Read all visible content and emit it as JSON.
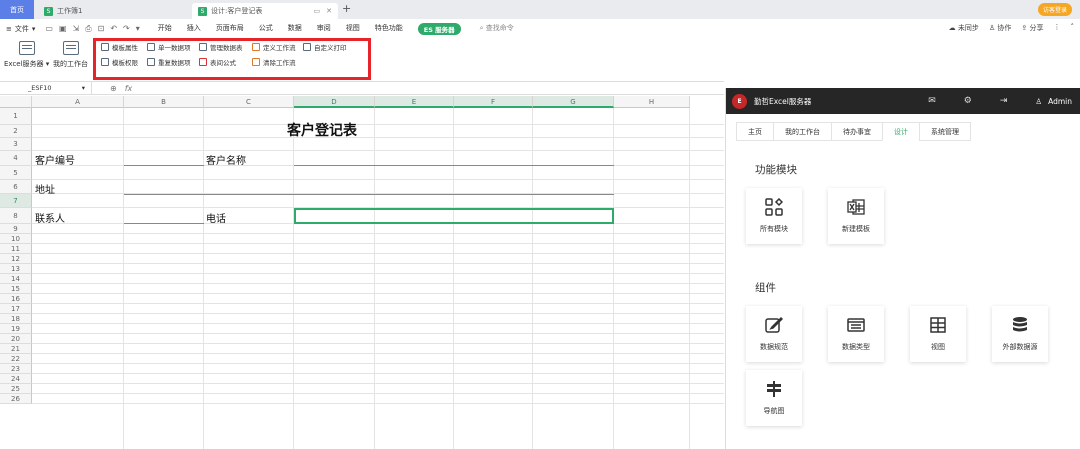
{
  "tabbar": {
    "home": "首页",
    "workbook": "工作簿1",
    "design_tab": "设计:客户登记表",
    "add": "+",
    "visitor_login": "访客登录"
  },
  "menubar": {
    "file": "文件",
    "items": [
      "开始",
      "插入",
      "页面布局",
      "公式",
      "数据",
      "审阅",
      "视图",
      "特色功能"
    ],
    "es_button": "ES 服务器",
    "search": "查找命令",
    "right_items": [
      "未同步",
      "协作",
      "分享"
    ]
  },
  "ribbon": {
    "excel_server": "Excel服务器",
    "my_workbench": "我的工作台",
    "row1": [
      "模板属性",
      "单一数据项",
      "管理数据表",
      "定义工作流",
      "自定义打印"
    ],
    "row2": [
      "模板权限",
      "重复数据项",
      "表间公式",
      "清除工作流"
    ]
  },
  "formula_bar": {
    "name_box": "_ESF10",
    "fx": "fx"
  },
  "grid": {
    "columns": [
      "A",
      "B",
      "C",
      "D",
      "E",
      "F",
      "G",
      "H"
    ],
    "rows": [
      "1",
      "2",
      "3",
      "4",
      "5",
      "6",
      "7",
      "8",
      "9",
      "10",
      "11",
      "12",
      "13",
      "14",
      "15",
      "16",
      "17",
      "18",
      "19",
      "20",
      "21",
      "22",
      "23",
      "24",
      "25",
      "26"
    ],
    "title": "客户登记表",
    "labels": {
      "customer_no": "客户编号",
      "customer_name": "客户名称",
      "address": "地址",
      "contact": "联系人",
      "phone": "电话"
    }
  },
  "panel": {
    "app_name": "勤哲Excel服务器",
    "user": "Admin",
    "logo": "E",
    "tabs": [
      "主页",
      "我的工作台",
      "待办事宜",
      "设计",
      "系统管理"
    ],
    "active_tab": "设计",
    "section_modules": "功能模块",
    "modules": [
      "所有模块",
      "新建模板"
    ],
    "section_components": "组件",
    "components": [
      "数据规范",
      "数据类型",
      "视图",
      "外部数据源",
      "导航图"
    ]
  },
  "colors": {
    "accent": "#2eaa6a",
    "highlight": "#e8242b",
    "header_dark": "#262626"
  }
}
